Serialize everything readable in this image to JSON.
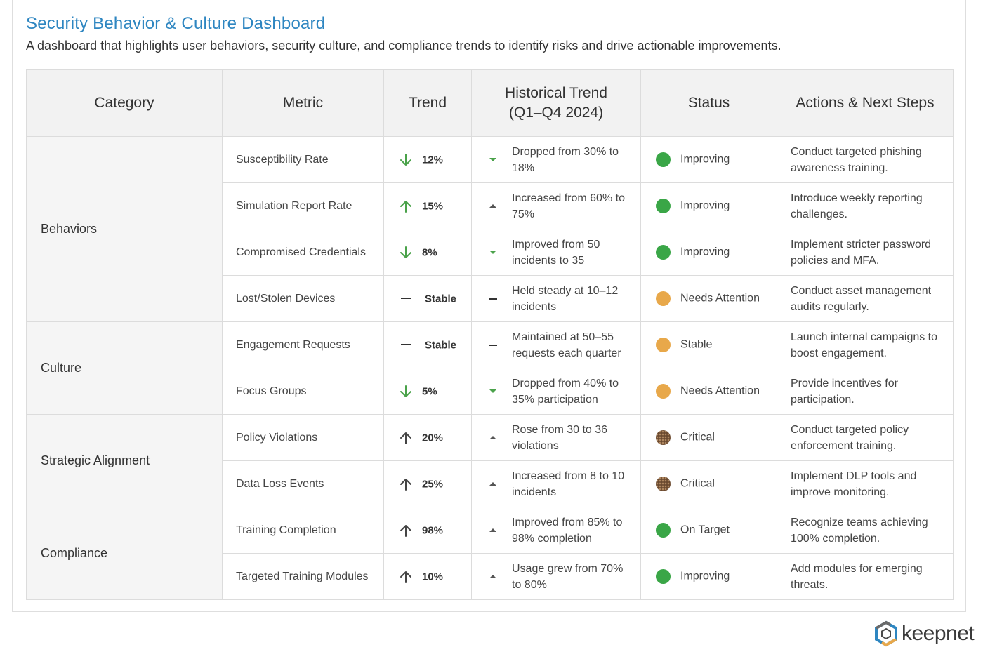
{
  "header": {
    "title": "Security Behavior & Culture Dashboard",
    "subtitle": "A dashboard that highlights user behaviors, security culture, and compliance trends to identify risks and drive actionable improvements."
  },
  "table": {
    "columns": {
      "category": "Category",
      "metric": "Metric",
      "trend": "Trend",
      "historical_line1": "Historical Trend",
      "historical_line2": "(Q1–Q4 2024)",
      "status": "Status",
      "actions": "Actions & Next Steps"
    },
    "categories": [
      "Behaviors",
      "Culture",
      "Strategic Alignment",
      "Compliance"
    ],
    "rows": [
      {
        "metric": "Susceptibility Rate",
        "trend": "12%",
        "trend_dir": "down",
        "hist_line1": "Dropped from 30% to",
        "hist_line2": "18%",
        "hist_icon": "down",
        "status": "Improving",
        "status_color": "#3aa647",
        "action_line1": "Conduct targeted phishing",
        "action_line2": "awareness training."
      },
      {
        "metric": "Simulation Report Rate",
        "trend": "15%",
        "trend_dir": "up-green",
        "hist_line1": "Increased from 60% to",
        "hist_line2": "75%",
        "hist_icon": "up",
        "status": "Improving",
        "status_color": "#3aa647",
        "action_line1": "Introduce weekly reporting",
        "action_line2": "challenges."
      },
      {
        "metric": "Compromised Credentials",
        "trend": "8%",
        "trend_dir": "down",
        "hist_line1": "Improved from 50",
        "hist_line2": "incidents to 35",
        "hist_icon": "down",
        "status": "Improving",
        "status_color": "#3aa647",
        "action_line1": "Implement stricter password",
        "action_line2": "policies and MFA."
      },
      {
        "metric": "Lost/Stolen Devices",
        "trend": "Stable",
        "trend_dir": "flat",
        "hist_line1": "Held steady at 10–12",
        "hist_line2": "incidents",
        "hist_icon": "flat",
        "status": "Needs Attention",
        "status_color": "#e8a84a",
        "action_line1": "Conduct asset management",
        "action_line2": "audits regularly."
      },
      {
        "metric": "Engagement Requests",
        "trend": "Stable",
        "trend_dir": "flat",
        "hist_line1": "Maintained at 50–55",
        "hist_line2": "requests each quarter",
        "hist_icon": "flat",
        "status": "Stable",
        "status_color": "#e8a84a",
        "action_line1": "Launch internal campaigns to",
        "action_line2": "boost engagement."
      },
      {
        "metric": "Focus Groups",
        "trend": "5%",
        "trend_dir": "down",
        "hist_line1": "Dropped from 40% to",
        "hist_line2": "35% participation",
        "hist_icon": "down",
        "status": "Needs Attention",
        "status_color": "#e8a84a",
        "action_line1": "Provide incentives for",
        "action_line2": "participation."
      },
      {
        "metric": "Policy Violations",
        "trend": "20%",
        "trend_dir": "up",
        "hist_line1": " Rose from 30 to 36",
        "hist_line2": "violations",
        "hist_icon": "up",
        "status": "Critical",
        "status_color": "#8a6a4a",
        "action_line1": "Conduct targeted policy",
        "action_line2": "enforcement training."
      },
      {
        "metric": "Data Loss Events",
        "trend": "25%",
        "trend_dir": "up",
        "hist_line1": "Increased from 8 to 10",
        "hist_line2": "incidents",
        "hist_icon": "up",
        "status": "Critical",
        "status_color": "#8a6a4a",
        "action_line1": "Implement DLP tools and",
        "action_line2": "improve monitoring."
      },
      {
        "metric": "Training Completion",
        "trend": "98%",
        "trend_dir": "up",
        "hist_line1": "Improved from 85% to",
        "hist_line2": "98% completion",
        "hist_icon": "up",
        "status": "On Target",
        "status_color": "#3aa647",
        "action_line1": "Recognize teams achieving",
        "action_line2": "100% completion."
      },
      {
        "metric": "Targeted Training Modules",
        "trend": "10%",
        "trend_dir": "up",
        "hist_line1": "Usage grew from 70%",
        "hist_line2": "to 80%",
        "hist_icon": "up",
        "status": "Improving",
        "status_color": "#3aa647",
        "action_line1": "Add modules for emerging",
        "action_line2": "threats."
      }
    ]
  },
  "brand": {
    "logo_text": "keepnet",
    "accent_color": "#2e86c1"
  }
}
